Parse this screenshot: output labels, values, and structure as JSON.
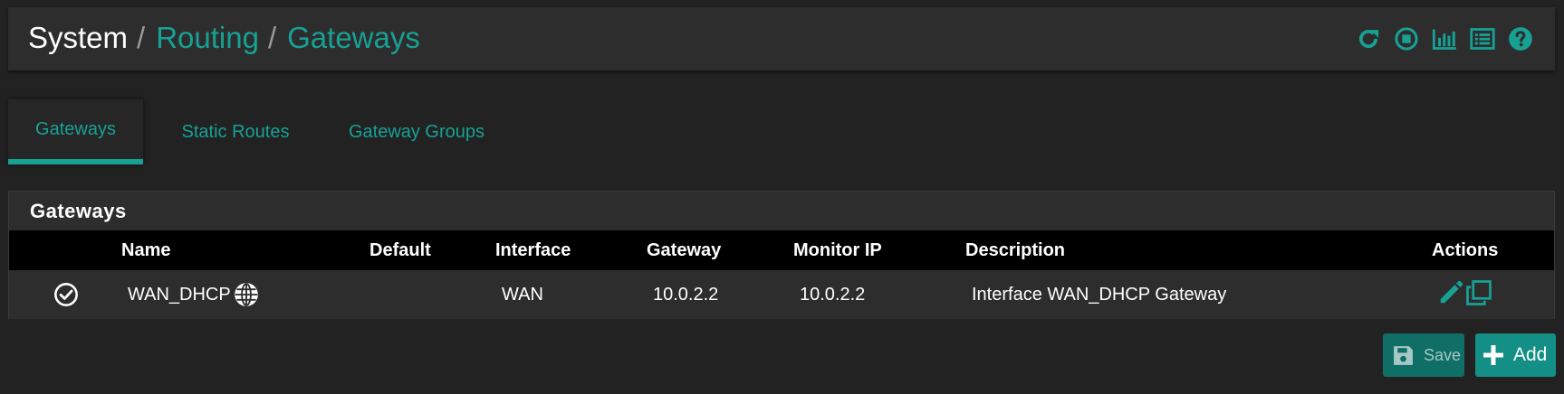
{
  "breadcrumb": {
    "root": "System",
    "items": [
      "Routing",
      "Gateways"
    ],
    "separator": "/"
  },
  "header_icons": [
    "reload-icon",
    "stop-circle-icon",
    "bar-chart-icon",
    "list-icon",
    "help-icon"
  ],
  "tabs": [
    {
      "label": "Gateways",
      "active": true
    },
    {
      "label": "Static Routes",
      "active": false
    },
    {
      "label": "Gateway Groups",
      "active": false
    }
  ],
  "panel": {
    "title": "Gateways",
    "columns": [
      "",
      "Name",
      "Default",
      "Interface",
      "Gateway",
      "Monitor IP",
      "Description",
      "Actions"
    ],
    "rows": [
      {
        "status_icon": "check-circle-icon",
        "name": "WAN_DHCP",
        "name_icon": "globe-icon",
        "default": "",
        "interface": "WAN",
        "gateway": "10.0.2.2",
        "monitor_ip": "10.0.2.2",
        "description": "Interface WAN_DHCP Gateway",
        "actions": [
          "edit-pencil-icon",
          "copy-icon"
        ]
      }
    ]
  },
  "buttons": {
    "save_label": "Save",
    "add_label": "Add"
  },
  "colors": {
    "accent": "#17a195",
    "background": "#222222",
    "panel": "#2d2d2d",
    "table_header": "#000000"
  }
}
